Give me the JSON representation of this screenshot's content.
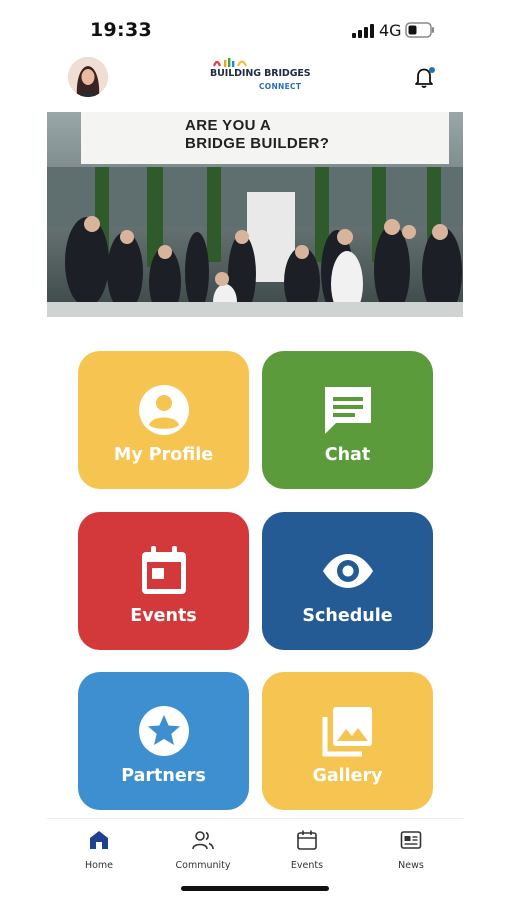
{
  "status_bar": {
    "time": "19:33",
    "network": "4G"
  },
  "header": {
    "logo_title": "BUILDING BRIDGES",
    "logo_subtitle": "CONNECT"
  },
  "hero": {
    "headline_line1": "ARE YOU A",
    "headline_line2": "BRIDGE BUILDER?"
  },
  "tiles": [
    {
      "label": "My Profile",
      "icon": "user-circle-icon",
      "color": "#f5c451"
    },
    {
      "label": "Chat",
      "icon": "chat-bubble-icon",
      "color": "#5b9b3c"
    },
    {
      "label": "Events",
      "icon": "calendar-icon",
      "color": "#d3383b"
    },
    {
      "label": "Schedule",
      "icon": "eye-icon",
      "color": "#245b95"
    },
    {
      "label": "Partners",
      "icon": "star-badge-icon",
      "color": "#3d8fcf"
    },
    {
      "label": "Gallery",
      "icon": "photo-library-icon",
      "color": "#f5c451"
    }
  ],
  "bottom_nav": [
    {
      "label": "Home",
      "icon": "home-icon",
      "active": true
    },
    {
      "label": "Community",
      "icon": "people-icon",
      "active": false
    },
    {
      "label": "Events",
      "icon": "calendar-icon",
      "active": false
    },
    {
      "label": "News",
      "icon": "newspaper-icon",
      "active": false
    }
  ],
  "colors": {
    "accent": "#2b6fb2",
    "nav_active": "#1f3f8f"
  }
}
